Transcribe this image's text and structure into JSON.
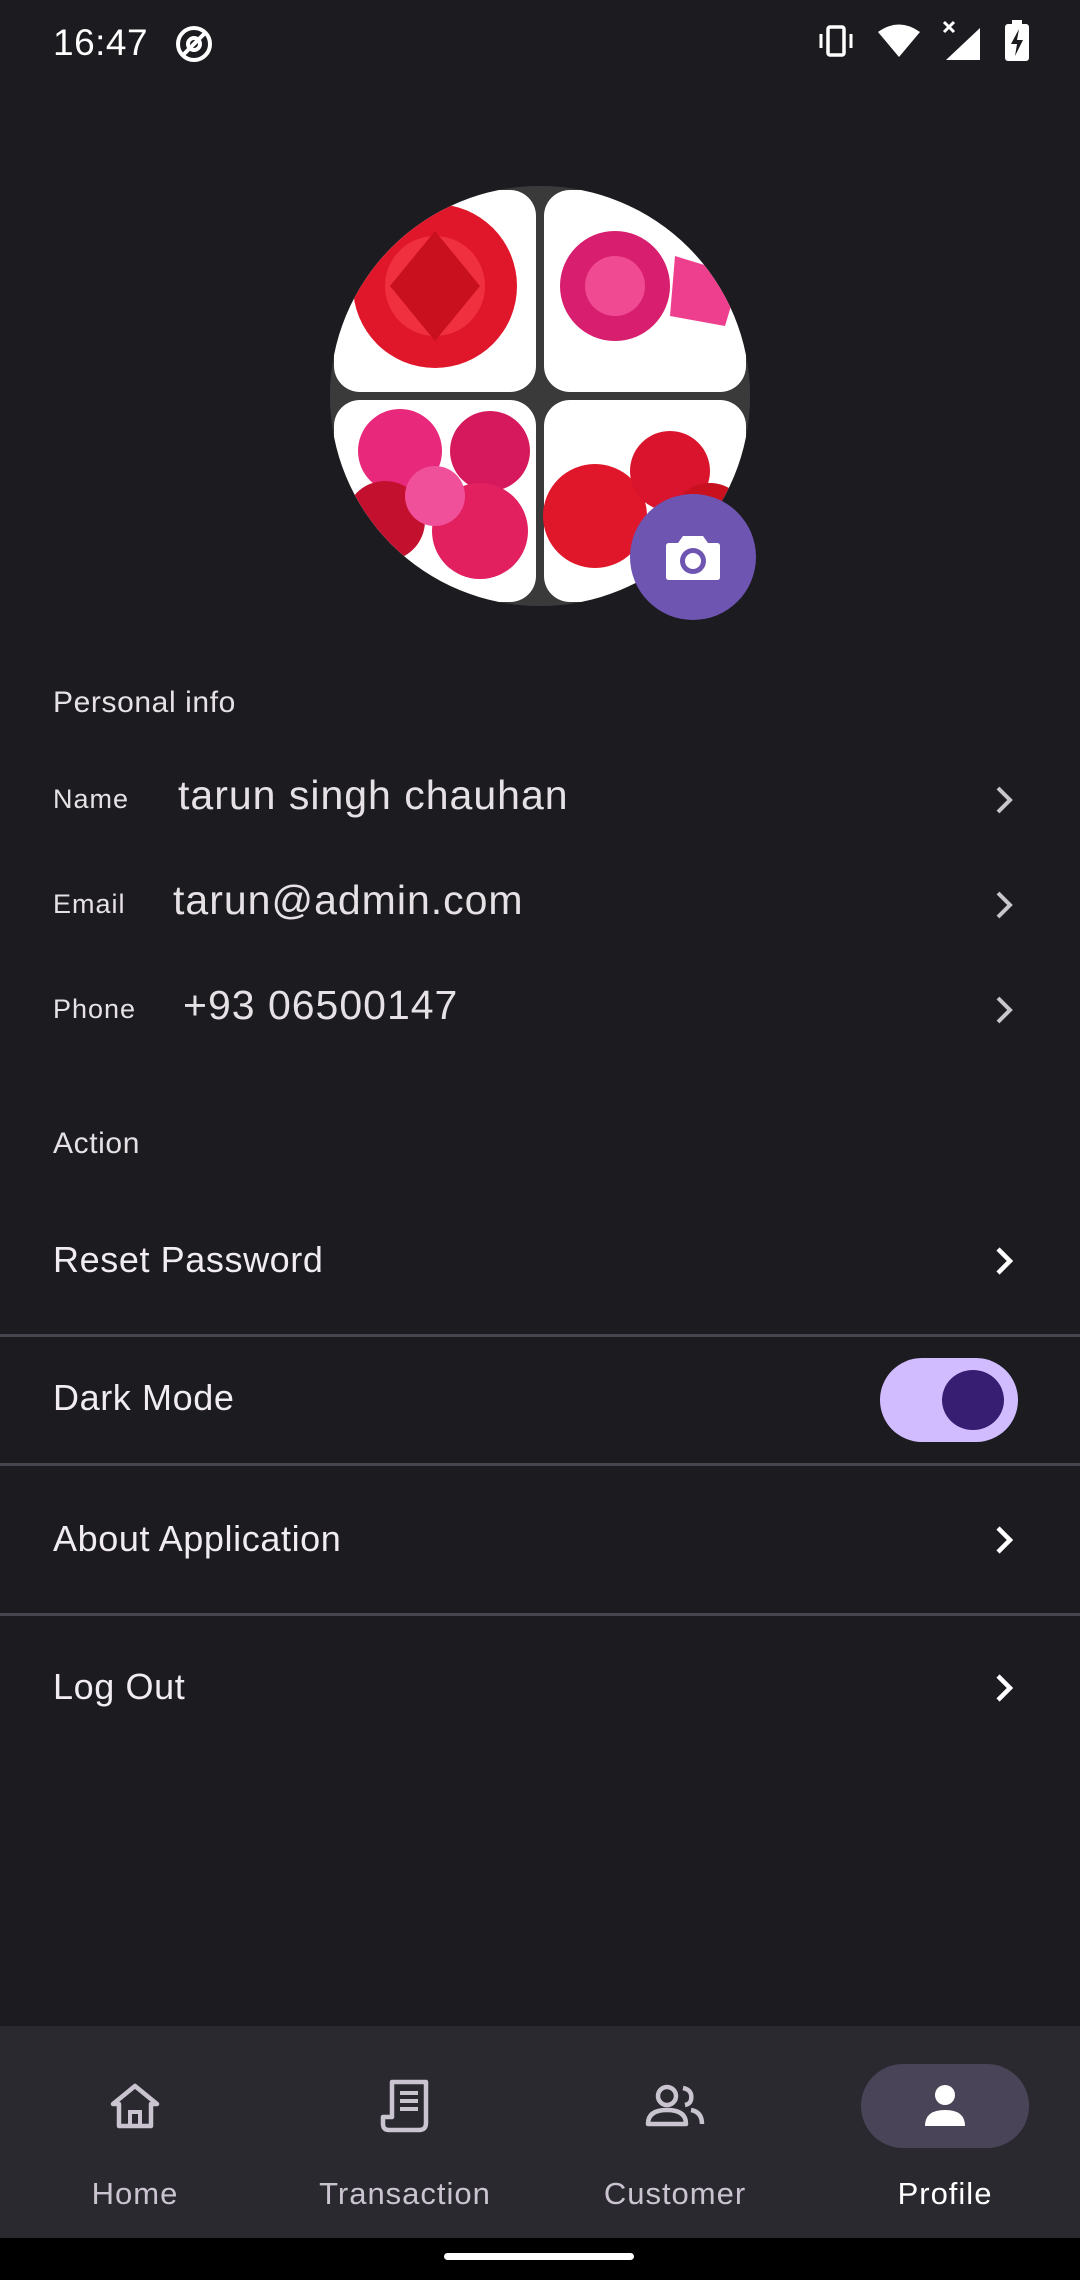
{
  "status_bar": {
    "time": "16:47"
  },
  "personal_info": {
    "section_label": "Personal info",
    "name_label": "Name",
    "name_value": "tarun singh chauhan",
    "email_label": "Email",
    "email_value": "tarun@admin.com",
    "phone_label": "Phone",
    "phone_value": "+93 06500147"
  },
  "actions": {
    "section_label": "Action",
    "reset_password": "Reset Password",
    "dark_mode": "Dark Mode",
    "dark_mode_on": true,
    "about_application": "About Application",
    "log_out": "Log Out"
  },
  "bottom_nav": {
    "items": [
      {
        "label": "Home",
        "icon": "home-icon",
        "active": false
      },
      {
        "label": "Transaction",
        "icon": "receipt-icon",
        "active": false
      },
      {
        "label": "Customer",
        "icon": "people-icon",
        "active": false
      },
      {
        "label": "Profile",
        "icon": "person-icon",
        "active": true
      }
    ]
  },
  "colors": {
    "background": "#1c1b1f",
    "accent": "#6e55b2",
    "toggle_track": "#d0bcff",
    "toggle_knob": "#381e72",
    "nav_background": "#2b2930"
  }
}
